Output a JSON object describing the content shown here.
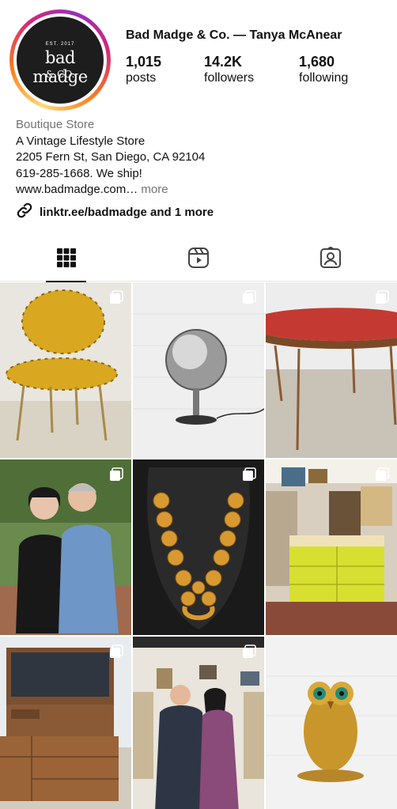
{
  "profile": {
    "account_name": "Bad Madge & Co. — Tanya McAnear",
    "avatar": {
      "est": "EST. 2017",
      "name": "bad madge",
      "co": "& CO."
    },
    "stats": [
      {
        "value": "1,015",
        "label": "posts"
      },
      {
        "value": "14.2K",
        "label": "followers"
      },
      {
        "value": "1,680",
        "label": "following"
      }
    ]
  },
  "bio": {
    "category": "Boutique Store",
    "lines": [
      "A Vintage Lifestyle Store",
      "2205 Fern St, San Diego, CA 92104",
      "619-285-1668. We ship!"
    ],
    "website": "www.badmadge.com…",
    "more": "more",
    "link": "linktr.ee/badmadge and 1 more"
  },
  "tabs": [
    {
      "icon": "grid-icon",
      "active": true
    },
    {
      "icon": "reels-icon",
      "active": false
    },
    {
      "icon": "tagged-icon",
      "active": false
    }
  ],
  "colors": {
    "text": "#111111",
    "muted": "#737373",
    "divider": "#e6e6e6"
  }
}
